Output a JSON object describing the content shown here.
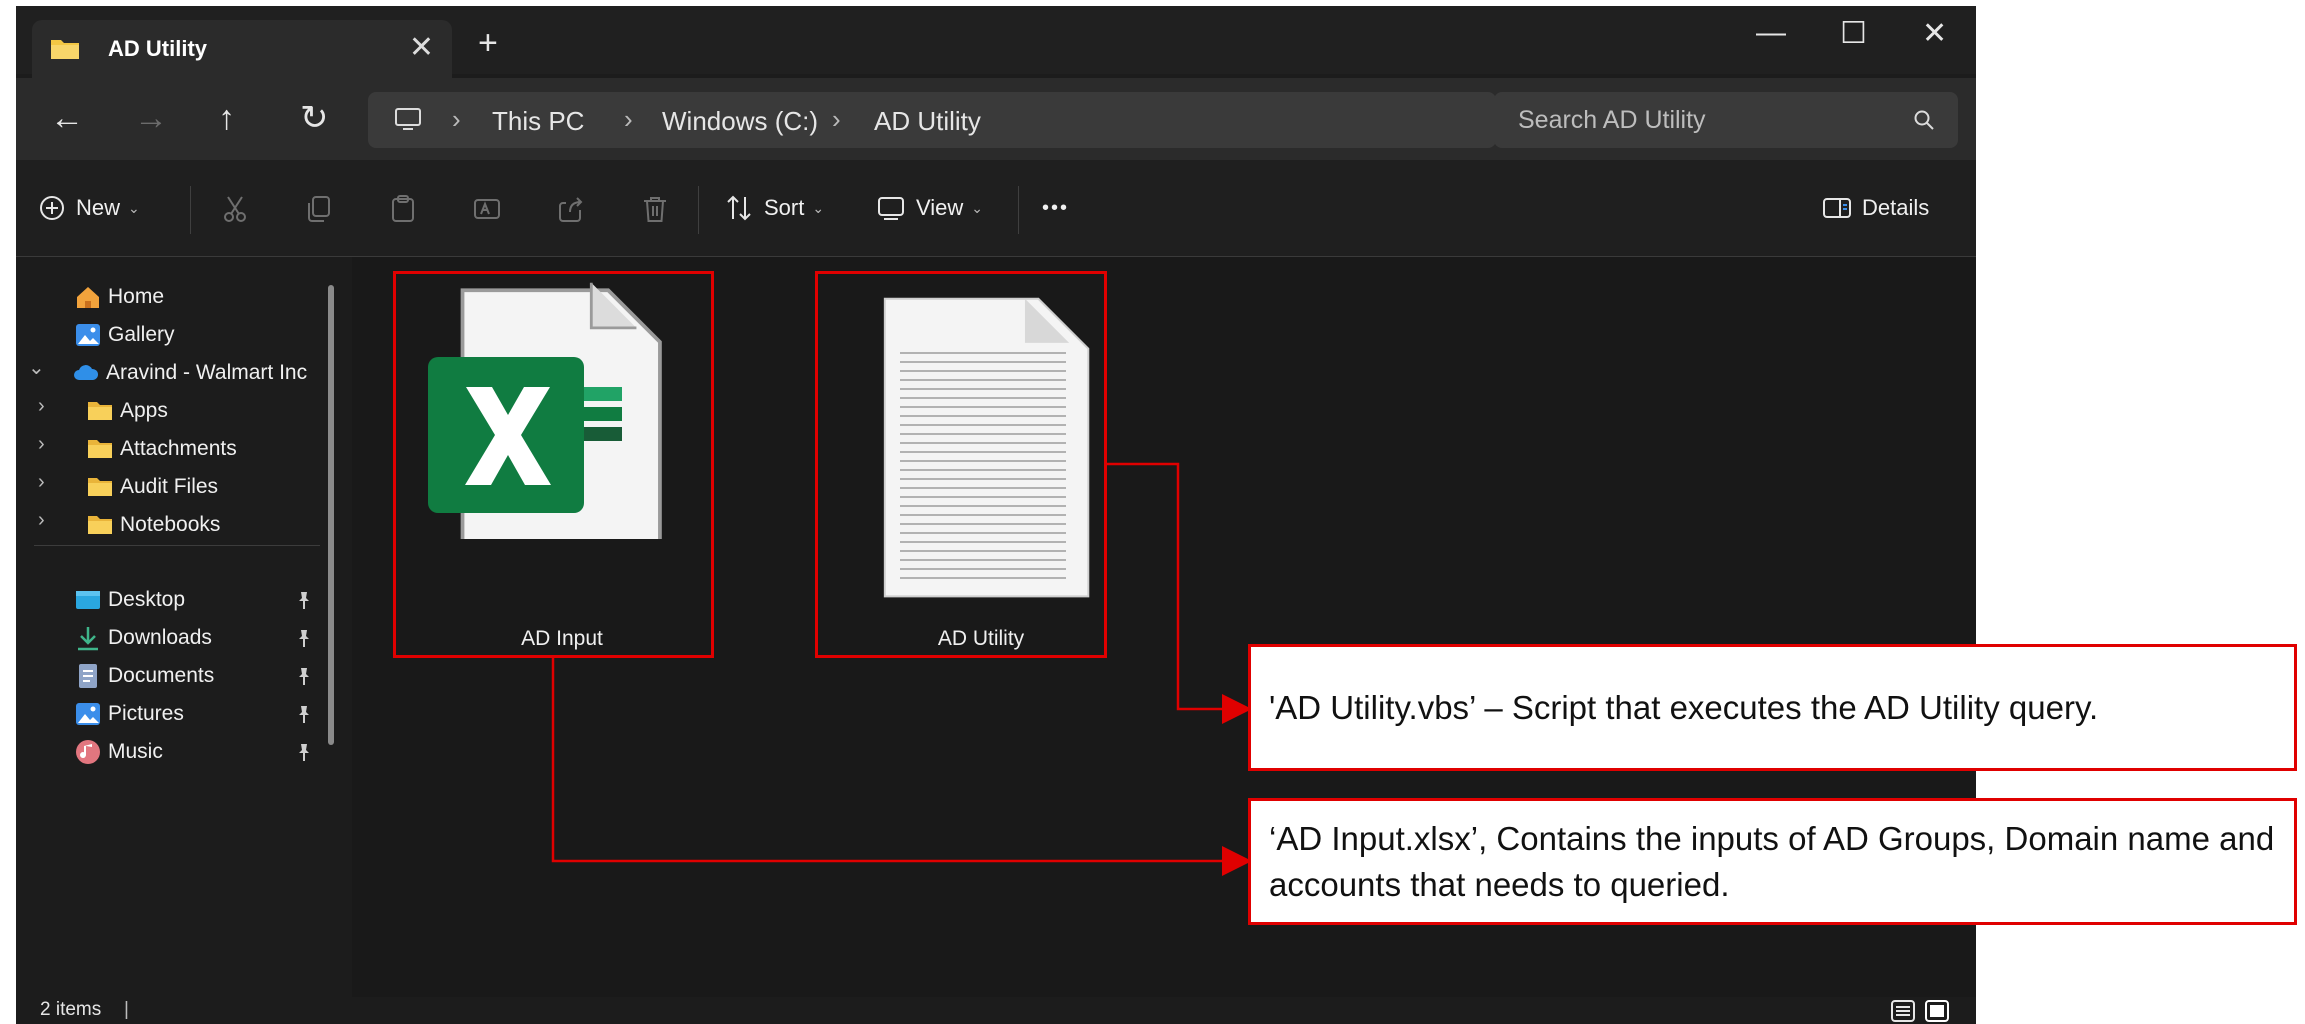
{
  "tab": {
    "title": "AD Utility",
    "close": "✕",
    "new": "+"
  },
  "window_controls": {
    "minimize": "—",
    "maximize": "☐",
    "close": "✕"
  },
  "nav": {
    "back": "←",
    "forward": "→",
    "up": "↑",
    "refresh": "↻"
  },
  "breadcrumb": {
    "items": [
      "This PC",
      "Windows (C:)",
      "AD Utility"
    ],
    "separator": "›"
  },
  "search": {
    "placeholder": "Search AD Utility"
  },
  "toolbar": {
    "new_label": "New",
    "sort_label": "Sort",
    "view_label": "View",
    "more_label": "•••",
    "details_label": "Details",
    "chevron": "⌄"
  },
  "sidebar": {
    "items": [
      {
        "label": "Home",
        "icon": "home-icon"
      },
      {
        "label": "Gallery",
        "icon": "gallery-icon"
      },
      {
        "label": "Aravind - Walmart Inc",
        "icon": "cloud-icon"
      },
      {
        "label": "Apps",
        "icon": "folder-icon"
      },
      {
        "label": "Attachments",
        "icon": "folder-icon"
      },
      {
        "label": "Audit Files",
        "icon": "folder-icon"
      },
      {
        "label": "Notebooks",
        "icon": "folder-icon"
      }
    ],
    "pinned": [
      {
        "label": "Desktop",
        "icon": "desktop-icon"
      },
      {
        "label": "Downloads",
        "icon": "download-icon"
      },
      {
        "label": "Documents",
        "icon": "document-icon"
      },
      {
        "label": "Pictures",
        "icon": "pictures-icon"
      },
      {
        "label": "Music",
        "icon": "music-icon"
      }
    ],
    "expand_open": "⌄",
    "expand_closed": "›"
  },
  "files": [
    {
      "label": "AD Input",
      "type": "excel"
    },
    {
      "label": "AD Utility",
      "type": "text"
    }
  ],
  "status": {
    "count": "2 items",
    "separator": "|"
  },
  "callouts": {
    "vbs": "'AD Utility.vbs’ – Script that executes the AD Utility query.",
    "xlsx": "‘AD Input.xlsx’, Contains the inputs of AD Groups, Domain name and accounts that needs to queried."
  },
  "colors": {
    "highlight_red": "#e00000",
    "excel_green": "#107c41",
    "folder_yellow": "#f3c744",
    "accent_blue": "#3b8eea"
  }
}
